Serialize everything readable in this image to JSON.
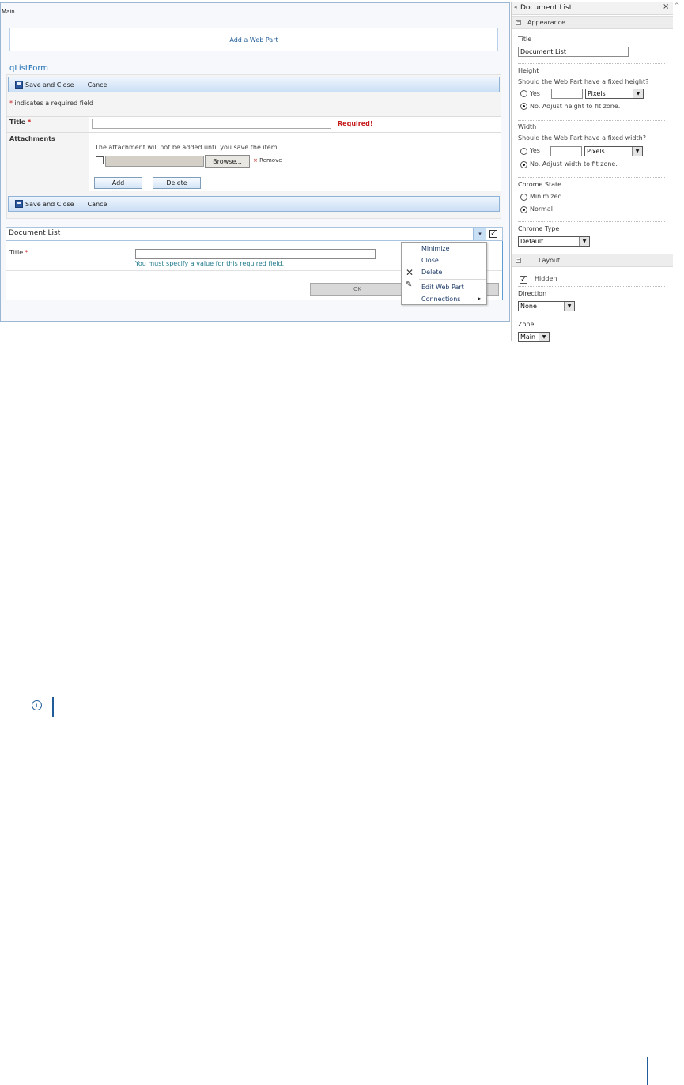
{
  "zone": {
    "label": "Main",
    "add_web_part": "Add a Web Part"
  },
  "qlistform": {
    "title": "qListForm",
    "toolbar": {
      "save_label": "Save and Close",
      "cancel_label": "Cancel"
    },
    "required_note_star": "*",
    "required_note": " indicates a required field",
    "title_label": "Title",
    "required_star": "*",
    "title_error": "Required!",
    "attachments_label": "Attachments",
    "attachment_note": "The attachment will not be added until you save the item",
    "browse_label": "Browse...",
    "remove_star": "×",
    "remove_label": "Remove",
    "add_label": "Add",
    "delete_label": "Delete"
  },
  "doclist": {
    "title": "Document List",
    "field_label": "Title",
    "field_star": "*",
    "validation": "You must specify a value for this required field.",
    "ok_label": "OK",
    "menu_arrow": "▾",
    "checked_glyph": "✓"
  },
  "context_menu": {
    "items": [
      "Minimize",
      "Close",
      "Delete",
      "Edit Web Part",
      "Connections"
    ],
    "submenu_arrow": "▸"
  },
  "tool_pane": {
    "title": "Document List",
    "close_glyph": "×",
    "back_glyph": "◂",
    "appearance": {
      "section": "Appearance",
      "title_label": "Title",
      "title_value": "Document List",
      "height_label": "Height",
      "height_question": "Should the Web Part have a fixed height?",
      "height_yes": "Yes",
      "height_units": "Pixels",
      "height_no": "No. Adjust height to fit zone.",
      "width_label": "Width",
      "width_question": "Should the Web Part have a fixed width?",
      "width_yes": "Yes",
      "width_units": "Pixels",
      "width_no": "No. Adjust width to fit zone.",
      "chrome_state_label": "Chrome State",
      "chrome_state_minimized": "Minimized",
      "chrome_state_normal": "Normal",
      "chrome_type_label": "Chrome Type",
      "chrome_type_value": "Default"
    },
    "layout": {
      "section": "Layout",
      "hidden_label": "Hidden",
      "direction_label": "Direction",
      "direction_value": "None",
      "zone_label": "Zone",
      "zone_value": "Main"
    }
  },
  "decor": {
    "info_glyph": "i",
    "scroll_up": "^",
    "collapse_glyph": "−",
    "select_arrow": "▼"
  }
}
